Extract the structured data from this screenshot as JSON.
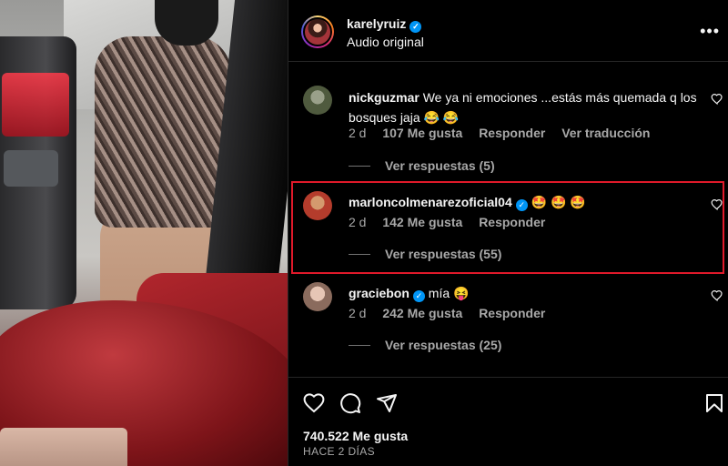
{
  "post": {
    "username": "karelyruiz",
    "subtitle": "Audio original",
    "more_label": "•••"
  },
  "comments": [
    {
      "username": "nickguzmar",
      "text": "We ya ni emociones ...estás más quemada q los bosques jaja 😂 😂",
      "time": "2 d",
      "likes": "107 Me gusta",
      "reply_label": "Responder",
      "translate_label": "Ver traducción",
      "view_replies": "Ver respuestas (5)",
      "verified": false
    },
    {
      "username": "marloncolmenarezoficial04",
      "text": "🤩 🤩 🤩",
      "time": "2 d",
      "likes": "142 Me gusta",
      "reply_label": "Responder",
      "view_replies": "Ver respuestas (55)",
      "verified": true
    },
    {
      "username": "graciebon",
      "text": "mía 😝",
      "time": "2 d",
      "likes": "242 Me gusta",
      "reply_label": "Responder",
      "view_replies": "Ver respuestas (25)",
      "verified": true
    }
  ],
  "footer": {
    "likes": "740.522 Me gusta",
    "date": "HACE 2 DÍAS"
  },
  "colors": {
    "background": "#000000",
    "text": "#f5f5f5",
    "muted": "#a8a8a8",
    "verified": "#0095f6",
    "highlight": "#e0192a"
  }
}
